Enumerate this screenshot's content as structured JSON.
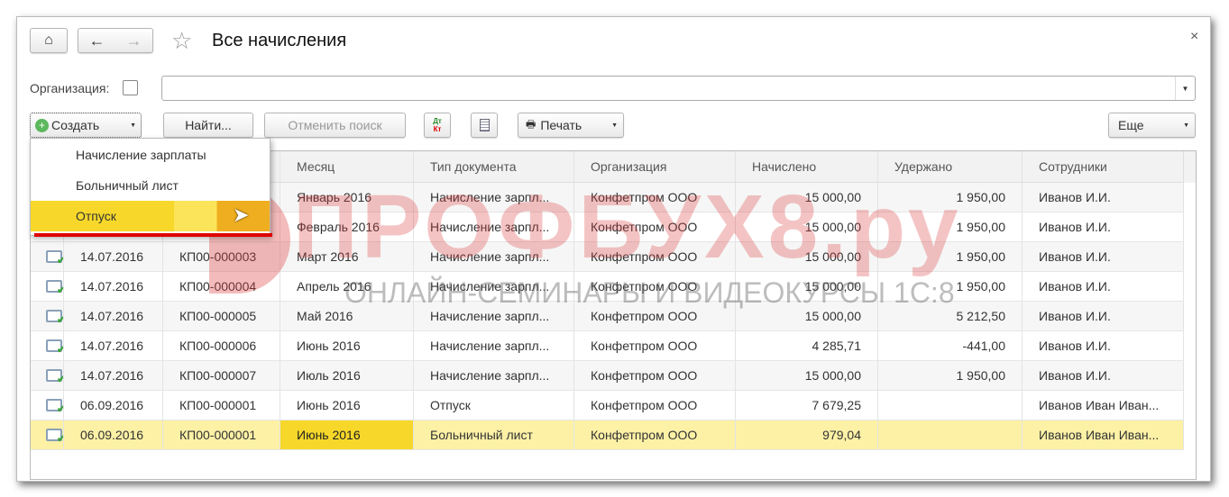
{
  "window": {
    "title": "Все начисления",
    "close": "×"
  },
  "filter": {
    "org_label": "Организация:",
    "org_value": ""
  },
  "toolbar": {
    "create": "Создать",
    "find": "Найти...",
    "cancel_search": "Отменить поиск",
    "dtkt_top": "Дт",
    "dtkt_bottom": "Кт",
    "print": "Печать",
    "more": "Еще"
  },
  "create_menu": [
    "Начисление зарплаты",
    "Больничный лист",
    "Отпуск"
  ],
  "columns": [
    "Месяц",
    "Тип документа",
    "Организация",
    "Начислено",
    "Удержано",
    "Сотрудники"
  ],
  "rows": [
    {
      "date": "",
      "num": "",
      "month": "Январь 2016",
      "type": "Начисление зарпл...",
      "org": "Конфетпром ООО",
      "accr": "15 000,00",
      "with": "1 950,00",
      "emp": "Иванов И.И."
    },
    {
      "date": "",
      "num": "",
      "month": "Февраль 2016",
      "type": "Начисление зарпл...",
      "org": "Конфетпром ООО",
      "accr": "15 000,00",
      "with": "1 950,00",
      "emp": "Иванов И.И."
    },
    {
      "date": "14.07.2016",
      "num": "КП00-000003",
      "month": "Март 2016",
      "type": "Начисление зарпл...",
      "org": "Конфетпром ООО",
      "accr": "15 000,00",
      "with": "1 950,00",
      "emp": "Иванов И.И."
    },
    {
      "date": "14.07.2016",
      "num": "КП00-000004",
      "month": "Апрель 2016",
      "type": "Начисление зарпл...",
      "org": "Конфетпром ООО",
      "accr": "15 000,00",
      "with": "1 950,00",
      "emp": "Иванов И.И."
    },
    {
      "date": "14.07.2016",
      "num": "КП00-000005",
      "month": "Май 2016",
      "type": "Начисление зарпл...",
      "org": "Конфетпром ООО",
      "accr": "15 000,00",
      "with": "5 212,50",
      "emp": "Иванов И.И."
    },
    {
      "date": "14.07.2016",
      "num": "КП00-000006",
      "month": "Июнь 2016",
      "type": "Начисление зарпл...",
      "org": "Конфетпром ООО",
      "accr": "4 285,71",
      "with": "-441,00",
      "emp": "Иванов И.И."
    },
    {
      "date": "14.07.2016",
      "num": "КП00-000007",
      "month": "Июль 2016",
      "type": "Начисление зарпл...",
      "org": "Конфетпром ООО",
      "accr": "15 000,00",
      "with": "1 950,00",
      "emp": "Иванов И.И."
    },
    {
      "date": "06.09.2016",
      "num": "КП00-000001",
      "month": "Июнь 2016",
      "type": "Отпуск",
      "org": "Конфетпром ООО",
      "accr": "7 679,25",
      "with": "",
      "emp": "Иванов Иван Иван..."
    },
    {
      "date": "06.09.2016",
      "num": "КП00-000001",
      "month": "Июнь 2016",
      "type": "Больничный лист",
      "org": "Конфетпром ООО",
      "accr": "979,04",
      "with": "",
      "emp": "Иванов Иван Иван..."
    }
  ],
  "watermark": {
    "brand": "ПРОФБУХ8.ру",
    "tagline": "ОНЛАЙН-СЕМИНАРЫ И ВИДЕОКУРСЫ 1С:8"
  },
  "colors": {
    "selected_row": "#fdf1a6",
    "selected_cell": "#f7d82a",
    "accent_red": "#e00000"
  }
}
